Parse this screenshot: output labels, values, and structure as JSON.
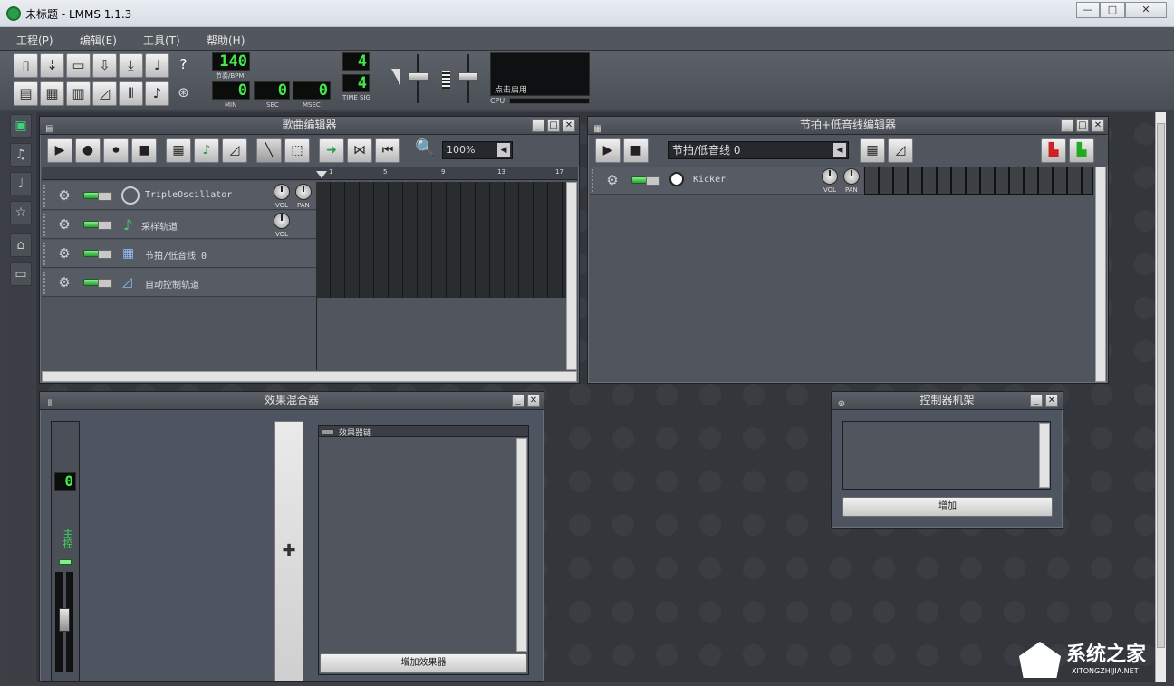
{
  "window": {
    "title": "未标题 - LMMS 1.1.3",
    "minimize": "—",
    "maximize": "□",
    "close": "✕"
  },
  "menu": [
    "工程(P)",
    "编辑(E)",
    "工具(T)",
    "帮助(H)"
  ],
  "toolbar": {
    "tempo": "140",
    "tempo_label": "节奏/BPM",
    "min": "0",
    "sec": "0",
    "msec": "0",
    "min_label": "MIN",
    "sec_label": "SEC",
    "msec_label": "MSEC",
    "timesig_num": "4",
    "timesig_den": "4",
    "timesig_label": "TIME SIG",
    "cpu_hint": "点击启用",
    "cpu_label": "CPU"
  },
  "song_editor": {
    "title": "歌曲编辑器",
    "zoom": "100%",
    "ruler": [
      "1",
      "5",
      "9",
      "13",
      "17"
    ],
    "tracks": [
      {
        "name": "TripleOscillator",
        "icon": "triple-oscillator-icon"
      },
      {
        "name": "采样轨道",
        "icon": "sample-track-icon"
      },
      {
        "name": "节拍/低音线 0",
        "icon": "beat-bassline-icon"
      },
      {
        "name": "自动控制轨道",
        "icon": "automation-icon"
      }
    ],
    "vol_label": "VOL",
    "pan_label": "PAN"
  },
  "bb_editor": {
    "title": "节拍+低音线编辑器",
    "pattern_select": "节拍/低音线 0",
    "tracks": [
      {
        "name": "Kicker"
      }
    ],
    "vol_label": "VOL",
    "pan_label": "PAN"
  },
  "fx_mixer": {
    "title": "效果混合器",
    "channel_value": "0",
    "channel_name": "主控",
    "chain_title": "效果器链",
    "add_effect": "增加效果器"
  },
  "controller_rack": {
    "title": "控制器机架",
    "add": "增加"
  },
  "watermark": {
    "brand": "系统之家",
    "url": "XITONGZHIJIA.NET"
  }
}
